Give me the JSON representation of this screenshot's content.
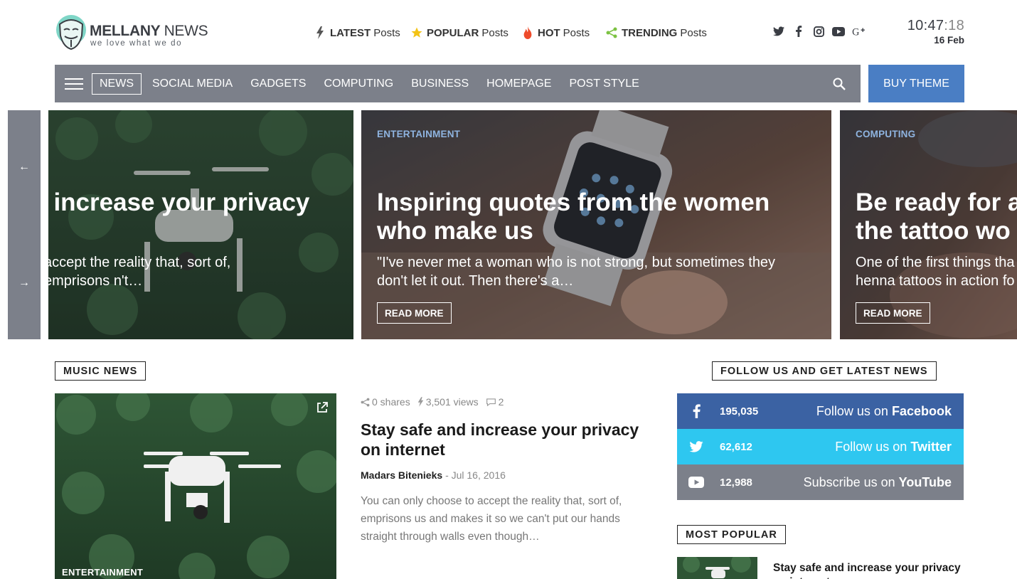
{
  "header": {
    "logo": {
      "name_bold": "MELLANY",
      "name_light": "NEWS",
      "tagline": "we love what we do"
    },
    "nav": [
      {
        "bold": "LATEST",
        "rest": "Posts",
        "icon": "bolt-icon"
      },
      {
        "bold": "POPULAR",
        "rest": "Posts",
        "icon": "star-icon"
      },
      {
        "bold": "HOT",
        "rest": "Posts",
        "icon": "fire-icon"
      },
      {
        "bold": "TRENDING",
        "rest": "Posts",
        "icon": "share-icon"
      }
    ],
    "socials": [
      "twitter-icon",
      "facebook-icon",
      "instagram-icon",
      "youtube-icon",
      "google-plus-icon"
    ],
    "clock": {
      "hm": "10:47",
      "sec": ":18",
      "date": "16 Feb"
    }
  },
  "navbar": {
    "items": [
      "NEWS",
      "SOCIAL MEDIA",
      "GADGETS",
      "COMPUTING",
      "BUSINESS",
      "HOMEPAGE",
      "POST STYLE"
    ],
    "active": "NEWS",
    "buy_label": "BUY THEME"
  },
  "slider": {
    "slides": [
      {
        "category": "",
        "title": "l increase your privacy",
        "excerpt": "accept the reality that, sort of, emprisons n't…",
        "read_more": ""
      },
      {
        "category": "ENTERTAINMENT",
        "title": "Inspiring quotes from the women\nwho make us",
        "excerpt": "\"I've never met a woman who is not strong, but sometimes they don't let it out. Then there's a…",
        "read_more": "READ MORE"
      },
      {
        "category": "COMPUTING",
        "title": "Be ready for a\nthe tattoo wo",
        "excerpt": "One of the first things tha henna tattoos in action fo",
        "read_more": "READ MORE"
      }
    ]
  },
  "music_news": {
    "label": "MUSIC NEWS",
    "post": {
      "category": "ENTERTAINMENT",
      "shares": "0 shares",
      "views": "3,501 views",
      "comments": "2",
      "title": "Stay safe and increase your privacy on internet",
      "author": "Madars Bitenieks",
      "date": "- Jul 16, 2016",
      "excerpt": "You can only choose to accept the reality that, sort of, emprisons us and makes it so we can't put our hands straight through walls even though…"
    }
  },
  "sidebar": {
    "follow_label": "FOLLOW US AND GET LATEST NEWS",
    "follows": [
      {
        "count": "195,035",
        "prefix": "Follow us on",
        "network": "Facebook",
        "color": "#3b62a3"
      },
      {
        "count": "62,612",
        "prefix": "Follow us on",
        "network": "Twitter",
        "color": "#2ec7f0"
      },
      {
        "count": "12,988",
        "prefix": "Subscribe us on",
        "network": "YouTube",
        "color": "#7c808a"
      }
    ],
    "most_popular_label": "MOST POPULAR",
    "most_popular": [
      {
        "title": "Stay safe and increase your privacy on internet"
      }
    ]
  },
  "colors": {
    "navbar": "#7c808a",
    "accent": "#4a7ec4",
    "category": "#8fb4e0"
  }
}
